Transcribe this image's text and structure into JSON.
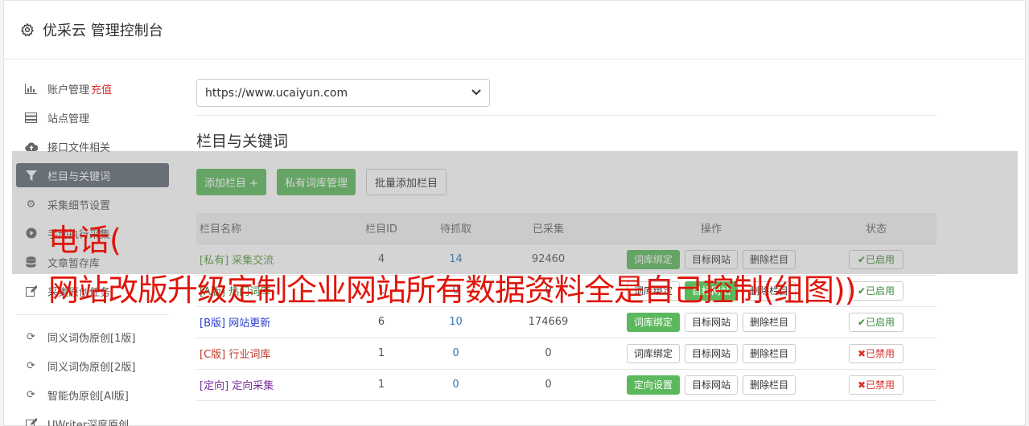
{
  "header": {
    "title": "优采云 管理控制台",
    "icon": "gear-icon"
  },
  "sidebar": {
    "items": [
      {
        "label": "账户管理",
        "extra": "充值",
        "icon": "bar-chart-icon"
      },
      {
        "label": "站点管理",
        "icon": "server-icon"
      },
      {
        "label": "接口文件相关",
        "icon": "cloud-upload-icon"
      },
      {
        "label": "栏目与关键词",
        "icon": "filter-icon",
        "active": true
      },
      {
        "label": "采集细节设置",
        "icon": "cogs-icon"
      },
      {
        "label": "手动执行采集",
        "icon": "play-circle-icon"
      },
      {
        "label": "文章暂存库",
        "icon": "database-icon"
      },
      {
        "label": "采集原创任务",
        "icon": "edit-icon"
      }
    ],
    "items2": [
      {
        "label": "同义词伪原创[1版]",
        "icon": "refresh-icon"
      },
      {
        "label": "同义词伪原创[2版]",
        "icon": "refresh-icon"
      },
      {
        "label": "智能伪原创[AI版]",
        "icon": "refresh-icon"
      },
      {
        "label": "UWriter深度原创",
        "icon": "edit-icon"
      }
    ]
  },
  "main": {
    "site_select": "https://www.ucaiyun.com",
    "section_title": "栏目与关键词",
    "buttons": {
      "add_column": "添加栏目 +",
      "private_lib": "私有词库管理",
      "batch_add": "批量添加栏目"
    },
    "table": {
      "headers": [
        "栏目名称",
        "栏目ID",
        "待抓取",
        "已采集",
        "操作",
        "状态"
      ],
      "rows": [
        {
          "tag": "[私有]",
          "name": "采集交流",
          "id": "4",
          "pending": "14",
          "collected": "92460",
          "op1": "词库绑定",
          "op2": "目标网站",
          "op3": "删除栏目",
          "status": "已启用"
        },
        {
          "tag": "[A版]",
          "name": "热门词库",
          "id": "1",
          "pending": "0",
          "collected": "0",
          "op1": "词库绑定",
          "op2": "目标网站",
          "op3": "删除栏目",
          "status": "已启用"
        },
        {
          "tag": "[B版]",
          "name": "网站更新",
          "id": "6",
          "pending": "10",
          "collected": "174669",
          "op1": "词库绑定",
          "op2": "目标网站",
          "op3": "删除栏目",
          "status": "已启用"
        },
        {
          "tag": "[C版]",
          "name": "行业词库",
          "id": "1",
          "pending": "0",
          "collected": "0",
          "op1": "词库绑定",
          "op2": "目标网站",
          "op3": "删除栏目",
          "status": "已禁用"
        },
        {
          "tag": "[定向]",
          "name": "定向采集",
          "id": "1",
          "pending": "0",
          "collected": "0",
          "op1": "定向设置",
          "op2": "目标网站",
          "op3": "删除栏目",
          "status": "已禁用"
        }
      ]
    }
  },
  "watermark": {
    "line1": "电话(",
    "line2": "网站改版升级定制企业网站所有数据资料全是自己控制(组图))"
  },
  "colors": {
    "active_nav": "#616a75",
    "green": "#5cb85c",
    "red": "#d9302c"
  }
}
